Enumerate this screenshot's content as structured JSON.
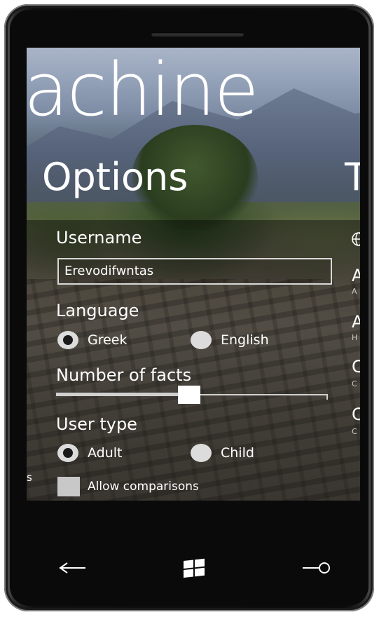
{
  "app": {
    "title": "achine",
    "pivot_header": "Options",
    "pivot_next": "T"
  },
  "options": {
    "username": {
      "label": "Username",
      "value": "Erevodifwntas"
    },
    "language": {
      "label": "Language",
      "options": [
        {
          "label": "Greek",
          "checked": true
        },
        {
          "label": "English",
          "checked": false
        }
      ]
    },
    "facts": {
      "label": "Number of facts",
      "value_fraction": 0.49
    },
    "user_type": {
      "label": "User type",
      "options": [
        {
          "label": "Adult",
          "checked": true
        },
        {
          "label": "Child",
          "checked": false
        }
      ]
    },
    "comparisons": {
      "label": "Allow comparisons",
      "checked": false
    }
  },
  "side_peek": {
    "items": [
      {
        "big": "A",
        "small": "A"
      },
      {
        "big": "A",
        "small": "H"
      },
      {
        "big": "C",
        "small": "C"
      },
      {
        "big": "C",
        "small": "C"
      }
    ],
    "icon": "globe-icon"
  },
  "left_peek": "s",
  "nav": {
    "back_icon": "back-arrow-icon",
    "start_icon": "windows-logo-icon",
    "search_icon": "search-icon"
  },
  "colors": {
    "accent": "#ffffff",
    "control": "#dcdcdc",
    "phone_body": "#0b0b0b"
  }
}
